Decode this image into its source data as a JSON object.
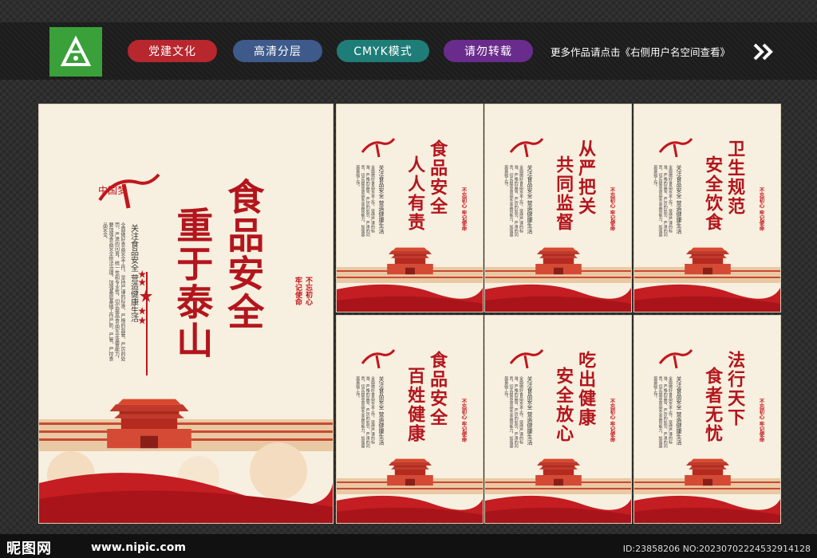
{
  "header": {
    "tags": [
      "党建文化",
      "高清分层",
      "CMYK模式",
      "请勿转载"
    ],
    "more_text": "更多作品请点击《右侧用户名空间查看》",
    "colors": {
      "tag1": "#b8262e",
      "tag2": "#3d5a8a",
      "tag3": "#1f7d78",
      "tag4": "#6a2c8c",
      "logo": "#3aa03a"
    }
  },
  "main_poster": {
    "title_col1": "食品安全",
    "title_col2": "重于泰山",
    "subtitle": "关注食品安全 营造健康生活",
    "motto_1": "不忘初心",
    "motto_2": "牢记使命",
    "body": "全面做好食品安全工作，坚持严谨的标准、严格的监管、严厉的处罚、严肃的问责，统一性和专业性，切实提高食品安全监管能力，要加强食品安全依法治理，加强基层基础工作严防、严管、严控食品安全。"
  },
  "small_posters": [
    {
      "col1": "食品安全",
      "col2": "人人有责"
    },
    {
      "col1": "从严把关",
      "col2": "共同监督"
    },
    {
      "col1": "卫生规范",
      "col2": "安全饮食"
    },
    {
      "col1": "食品安全",
      "col2": "百姓健康"
    },
    {
      "col1": "吃出健康",
      "col2": "安全放心"
    },
    {
      "col1": "法行天下",
      "col2": "食者无忧"
    }
  ],
  "small_common": {
    "subtitle": "关注食品安全 营造健康生活",
    "motto": "不忘初心 牢记使命",
    "body": "全面做好食品安全工作，坚持严谨的标准、严格的监管、严厉的处罚、严肃的问责，切实提高食品安全监管能力，加强基层基础工作。"
  },
  "footer": {
    "logo": "昵图网",
    "url": "www.nipic.com",
    "id_text": "ID:23858206 NO:20230702224532914128"
  }
}
